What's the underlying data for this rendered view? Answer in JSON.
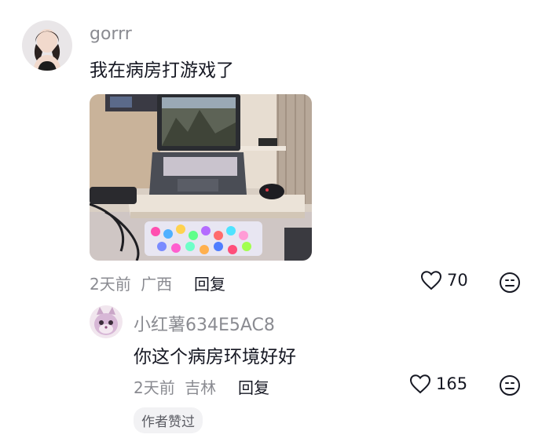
{
  "comments": [
    {
      "username": "gorrr",
      "text": "我在病房打游戏了",
      "time": "2天前",
      "location": "广西",
      "reply_label": "回复",
      "likes": "70"
    }
  ],
  "reply": {
    "username": "小红薯634E5AC8",
    "text": "你这个病房环境好好",
    "time": "2天前",
    "location": "吉林",
    "reply_label": "回复",
    "likes": "165",
    "author_badge": "作者赞过"
  },
  "icons": {
    "like": "heart-outline-icon",
    "emoji": "emoji-face-icon"
  },
  "colors": {
    "username": "#8a8b91",
    "text": "#161823",
    "badge_bg": "#f2f2f4"
  }
}
